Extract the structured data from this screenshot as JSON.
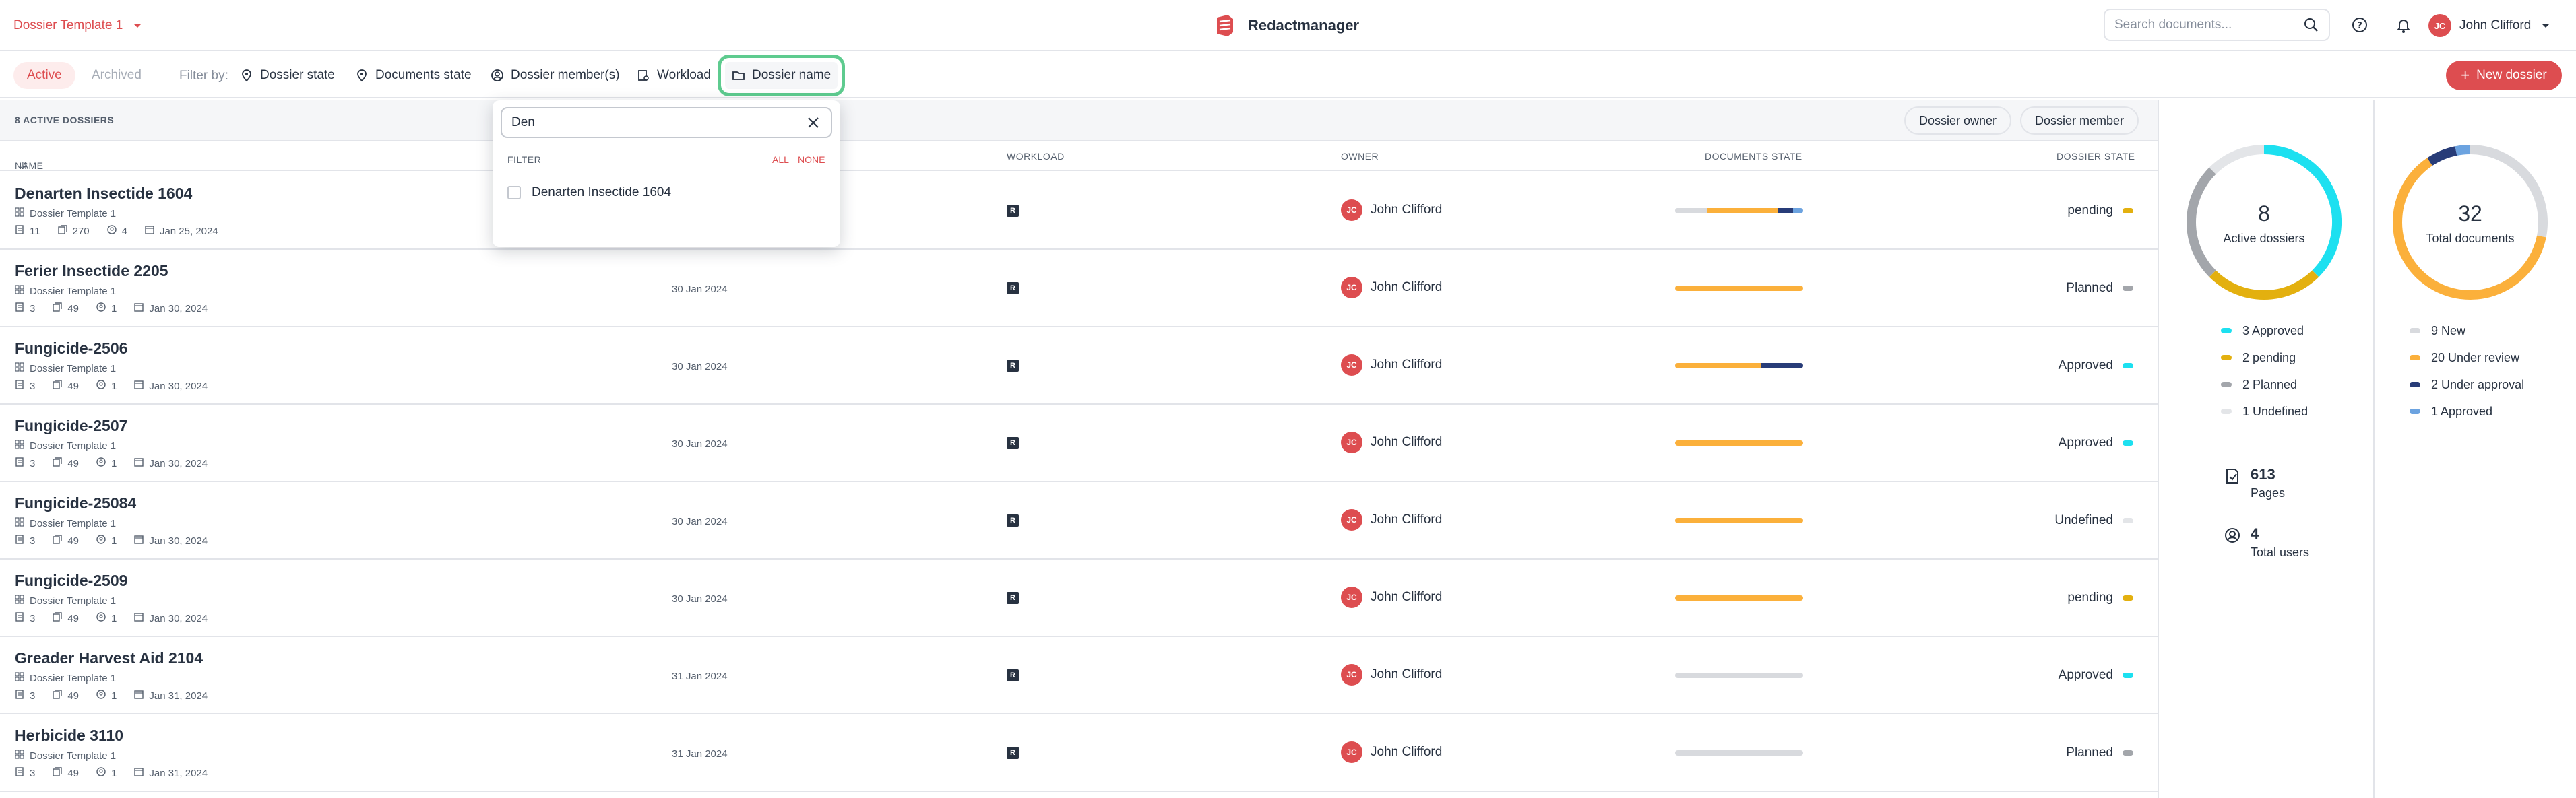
{
  "header": {
    "template_select": "Dossier Template 1",
    "brand": "Redactmanager",
    "search_placeholder": "Search documents...",
    "user_initials": "JC",
    "user_name": "John Clifford"
  },
  "filterbar": {
    "tab_active": "Active",
    "tab_archived": "Archived",
    "filter_by": "Filter by:",
    "filters": [
      "Dossier state",
      "Documents state",
      "Dossier member(s)",
      "Workload",
      "Dossier name"
    ],
    "new_dossier": "New dossier"
  },
  "list": {
    "count_label": "8 ACTIVE DOSSIERS",
    "owner_btn": "Dossier owner",
    "member_btn": "Dossier member",
    "columns": {
      "name": "NAME",
      "workload": "WORKLOAD",
      "owner": "OWNER",
      "documents_state": "DOCUMENTS STATE",
      "dossier_state": "DOSSIER STATE"
    },
    "rows": [
      {
        "name": "Denarten Insectide 1604",
        "template": "Dossier Template 1",
        "docs": "11",
        "pages": "270",
        "members": "4",
        "due": "Jan 25, 2024",
        "date": "",
        "wl": "R",
        "owner_initials": "JC",
        "owner": "John Clifford",
        "state": "pending",
        "state_color": "#e3b00f",
        "bar": [
          {
            "c": "#d8dade",
            "w": 0.25
          },
          {
            "c": "#fbb03b",
            "w": 0.55
          },
          {
            "c": "#283c78",
            "w": 0.12
          },
          {
            "c": "#6ca3e0",
            "w": 0.08
          }
        ]
      },
      {
        "name": "Ferier Insectide 2205",
        "template": "Dossier Template 1",
        "docs": "3",
        "pages": "49",
        "members": "1",
        "due": "Jan 30, 2024",
        "date": "30 Jan 2024",
        "wl": "R",
        "owner_initials": "JC",
        "owner": "John Clifford",
        "state": "Planned",
        "state_color": "#a3a6ab",
        "bar": [
          {
            "c": "#fbb03b",
            "w": 1
          }
        ]
      },
      {
        "name": "Fungicide-2506",
        "template": "Dossier Template 1",
        "docs": "3",
        "pages": "49",
        "members": "1",
        "due": "Jan 30, 2024",
        "date": "30 Jan 2024",
        "wl": "R",
        "owner_initials": "JC",
        "owner": "John Clifford",
        "state": "Approved",
        "state_color": "#1de0f0",
        "bar": [
          {
            "c": "#fbb03b",
            "w": 0.67
          },
          {
            "c": "#283c78",
            "w": 0.33
          }
        ]
      },
      {
        "name": "Fungicide-2507",
        "template": "Dossier Template 1",
        "docs": "3",
        "pages": "49",
        "members": "1",
        "due": "Jan 30, 2024",
        "date": "30 Jan 2024",
        "wl": "R",
        "owner_initials": "JC",
        "owner": "John Clifford",
        "state": "Approved",
        "state_color": "#1de0f0",
        "bar": [
          {
            "c": "#fbb03b",
            "w": 1
          }
        ]
      },
      {
        "name": "Fungicide-25084",
        "template": "Dossier Template 1",
        "docs": "3",
        "pages": "49",
        "members": "1",
        "due": "Jan 30, 2024",
        "date": "30 Jan 2024",
        "wl": "R",
        "owner_initials": "JC",
        "owner": "John Clifford",
        "state": "Undefined",
        "state_color": "#e3e5e8",
        "bar": [
          {
            "c": "#fbb03b",
            "w": 1
          }
        ]
      },
      {
        "name": "Fungicide-2509",
        "template": "Dossier Template 1",
        "docs": "3",
        "pages": "49",
        "members": "1",
        "due": "Jan 30, 2024",
        "date": "30 Jan 2024",
        "wl": "R",
        "owner_initials": "JC",
        "owner": "John Clifford",
        "state": "pending",
        "state_color": "#e3b00f",
        "bar": [
          {
            "c": "#fbb03b",
            "w": 1
          }
        ]
      },
      {
        "name": "Greader Harvest Aid 2104",
        "template": "Dossier Template 1",
        "docs": "3",
        "pages": "49",
        "members": "1",
        "due": "Jan 31, 2024",
        "date": "31 Jan 2024",
        "wl": "R",
        "owner_initials": "JC",
        "owner": "John Clifford",
        "state": "Approved",
        "state_color": "#1de0f0",
        "bar": [
          {
            "c": "#d8dade",
            "w": 1
          }
        ]
      },
      {
        "name": "Herbicide 3110",
        "template": "Dossier Template 1",
        "docs": "3",
        "pages": "49",
        "members": "1",
        "due": "Jan 31, 2024",
        "date": "31 Jan 2024",
        "wl": "R",
        "owner_initials": "JC",
        "owner": "John Clifford",
        "state": "Planned",
        "state_color": "#a3a6ab",
        "bar": [
          {
            "c": "#d8dade",
            "w": 1
          }
        ]
      }
    ]
  },
  "dropdown": {
    "search_value": "Den",
    "filter_label": "FILTER",
    "all": "ALL",
    "none": "NONE",
    "options": [
      "Denarten Insectide 1604"
    ]
  },
  "stats": {
    "dossiers": {
      "total": "8",
      "label": "Active dossiers",
      "segments": [
        {
          "label": "3 Approved",
          "value": 3,
          "color": "#1de0f0"
        },
        {
          "label": "2 pending",
          "value": 2,
          "color": "#e3b00f"
        },
        {
          "label": "2 Planned",
          "value": 2,
          "color": "#a3a6ab"
        },
        {
          "label": "1 Undefined",
          "value": 1,
          "color": "#e3e5e8"
        }
      ]
    },
    "documents": {
      "total": "32",
      "label": "Total documents",
      "segments": [
        {
          "label": "9 New",
          "value": 9,
          "color": "#d8dade"
        },
        {
          "label": "20 Under review",
          "value": 20,
          "color": "#fbb03b"
        },
        {
          "label": "2 Under approval",
          "value": 2,
          "color": "#283c78"
        },
        {
          "label": "1 Approved",
          "value": 1,
          "color": "#6ca3e0"
        }
      ]
    },
    "pages": {
      "value": "613",
      "label": "Pages"
    },
    "users": {
      "value": "4",
      "label": "Total users"
    }
  }
}
